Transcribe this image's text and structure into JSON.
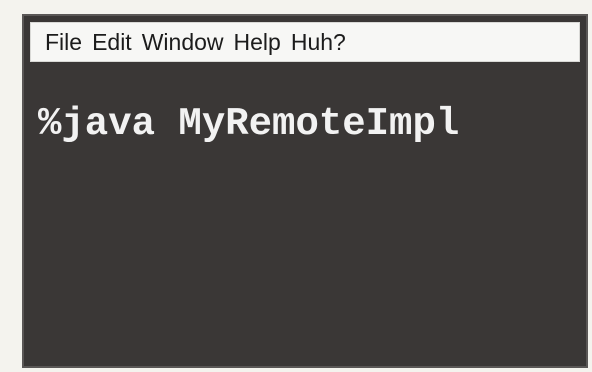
{
  "menubar": {
    "items": [
      {
        "label": "File"
      },
      {
        "label": "Edit"
      },
      {
        "label": "Window"
      },
      {
        "label": "Help"
      },
      {
        "label": "Huh?"
      }
    ]
  },
  "terminal": {
    "prompt": "%",
    "command": "java MyRemoteImpl"
  },
  "colors": {
    "terminal_background": "#3a3736",
    "terminal_text": "#f2f2f2",
    "menubar_background": "#f7f7f5"
  }
}
